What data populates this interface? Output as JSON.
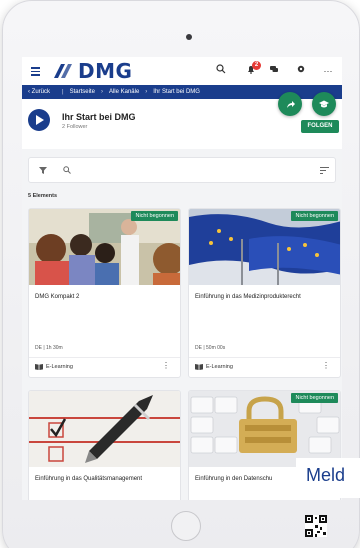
{
  "app": {
    "logo_text": "DMG",
    "brand_color": "#1a3d8c",
    "accent_color": "#1e8a5a",
    "notification_count": "2"
  },
  "breadcrumb": {
    "back_label": "Zurück",
    "items": [
      "Startseite",
      "Alle Kanäle",
      "Ihr Start bei DMG"
    ]
  },
  "channel": {
    "title": "Ihr Start bei DMG",
    "followers": "2 Follower",
    "follow_label": "FOLGEN"
  },
  "list": {
    "count_label": "5 Elements"
  },
  "cards": [
    {
      "title": "DMG Kompakt 2",
      "status": "Nicht begonnen",
      "meta": "DE | 1h 30m",
      "type": "E-Learning"
    },
    {
      "title": "Einführung in das Medizinprodukterecht",
      "status": "Nicht begonnen",
      "meta": "DE | 50m 00s",
      "type": "E-Learning"
    },
    {
      "title": "Einführung in das Qualitätsmanagement",
      "status": "",
      "meta": "",
      "type": ""
    },
    {
      "title": "Einführung in den Datenschu",
      "status": "Nicht begonnen",
      "meta": "",
      "type": ""
    }
  ],
  "overlay": {
    "text": "Meld"
  }
}
